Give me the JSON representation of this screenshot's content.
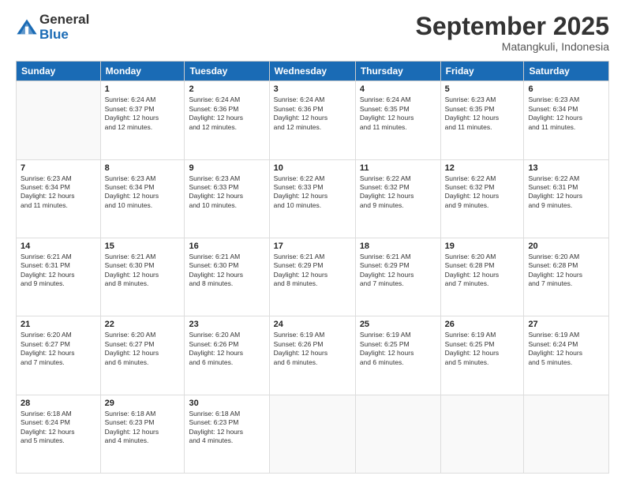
{
  "logo": {
    "general": "General",
    "blue": "Blue"
  },
  "header": {
    "month": "September 2025",
    "location": "Matangkuli, Indonesia"
  },
  "weekdays": [
    "Sunday",
    "Monday",
    "Tuesday",
    "Wednesday",
    "Thursday",
    "Friday",
    "Saturday"
  ],
  "weeks": [
    [
      {
        "day": "",
        "info": ""
      },
      {
        "day": "1",
        "info": "Sunrise: 6:24 AM\nSunset: 6:37 PM\nDaylight: 12 hours\nand 12 minutes."
      },
      {
        "day": "2",
        "info": "Sunrise: 6:24 AM\nSunset: 6:36 PM\nDaylight: 12 hours\nand 12 minutes."
      },
      {
        "day": "3",
        "info": "Sunrise: 6:24 AM\nSunset: 6:36 PM\nDaylight: 12 hours\nand 12 minutes."
      },
      {
        "day": "4",
        "info": "Sunrise: 6:24 AM\nSunset: 6:35 PM\nDaylight: 12 hours\nand 11 minutes."
      },
      {
        "day": "5",
        "info": "Sunrise: 6:23 AM\nSunset: 6:35 PM\nDaylight: 12 hours\nand 11 minutes."
      },
      {
        "day": "6",
        "info": "Sunrise: 6:23 AM\nSunset: 6:34 PM\nDaylight: 12 hours\nand 11 minutes."
      }
    ],
    [
      {
        "day": "7",
        "info": "Sunrise: 6:23 AM\nSunset: 6:34 PM\nDaylight: 12 hours\nand 11 minutes."
      },
      {
        "day": "8",
        "info": "Sunrise: 6:23 AM\nSunset: 6:34 PM\nDaylight: 12 hours\nand 10 minutes."
      },
      {
        "day": "9",
        "info": "Sunrise: 6:23 AM\nSunset: 6:33 PM\nDaylight: 12 hours\nand 10 minutes."
      },
      {
        "day": "10",
        "info": "Sunrise: 6:22 AM\nSunset: 6:33 PM\nDaylight: 12 hours\nand 10 minutes."
      },
      {
        "day": "11",
        "info": "Sunrise: 6:22 AM\nSunset: 6:32 PM\nDaylight: 12 hours\nand 9 minutes."
      },
      {
        "day": "12",
        "info": "Sunrise: 6:22 AM\nSunset: 6:32 PM\nDaylight: 12 hours\nand 9 minutes."
      },
      {
        "day": "13",
        "info": "Sunrise: 6:22 AM\nSunset: 6:31 PM\nDaylight: 12 hours\nand 9 minutes."
      }
    ],
    [
      {
        "day": "14",
        "info": "Sunrise: 6:21 AM\nSunset: 6:31 PM\nDaylight: 12 hours\nand 9 minutes."
      },
      {
        "day": "15",
        "info": "Sunrise: 6:21 AM\nSunset: 6:30 PM\nDaylight: 12 hours\nand 8 minutes."
      },
      {
        "day": "16",
        "info": "Sunrise: 6:21 AM\nSunset: 6:30 PM\nDaylight: 12 hours\nand 8 minutes."
      },
      {
        "day": "17",
        "info": "Sunrise: 6:21 AM\nSunset: 6:29 PM\nDaylight: 12 hours\nand 8 minutes."
      },
      {
        "day": "18",
        "info": "Sunrise: 6:21 AM\nSunset: 6:29 PM\nDaylight: 12 hours\nand 7 minutes."
      },
      {
        "day": "19",
        "info": "Sunrise: 6:20 AM\nSunset: 6:28 PM\nDaylight: 12 hours\nand 7 minutes."
      },
      {
        "day": "20",
        "info": "Sunrise: 6:20 AM\nSunset: 6:28 PM\nDaylight: 12 hours\nand 7 minutes."
      }
    ],
    [
      {
        "day": "21",
        "info": "Sunrise: 6:20 AM\nSunset: 6:27 PM\nDaylight: 12 hours\nand 7 minutes."
      },
      {
        "day": "22",
        "info": "Sunrise: 6:20 AM\nSunset: 6:27 PM\nDaylight: 12 hours\nand 6 minutes."
      },
      {
        "day": "23",
        "info": "Sunrise: 6:20 AM\nSunset: 6:26 PM\nDaylight: 12 hours\nand 6 minutes."
      },
      {
        "day": "24",
        "info": "Sunrise: 6:19 AM\nSunset: 6:26 PM\nDaylight: 12 hours\nand 6 minutes."
      },
      {
        "day": "25",
        "info": "Sunrise: 6:19 AM\nSunset: 6:25 PM\nDaylight: 12 hours\nand 6 minutes."
      },
      {
        "day": "26",
        "info": "Sunrise: 6:19 AM\nSunset: 6:25 PM\nDaylight: 12 hours\nand 5 minutes."
      },
      {
        "day": "27",
        "info": "Sunrise: 6:19 AM\nSunset: 6:24 PM\nDaylight: 12 hours\nand 5 minutes."
      }
    ],
    [
      {
        "day": "28",
        "info": "Sunrise: 6:18 AM\nSunset: 6:24 PM\nDaylight: 12 hours\nand 5 minutes."
      },
      {
        "day": "29",
        "info": "Sunrise: 6:18 AM\nSunset: 6:23 PM\nDaylight: 12 hours\nand 4 minutes."
      },
      {
        "day": "30",
        "info": "Sunrise: 6:18 AM\nSunset: 6:23 PM\nDaylight: 12 hours\nand 4 minutes."
      },
      {
        "day": "",
        "info": ""
      },
      {
        "day": "",
        "info": ""
      },
      {
        "day": "",
        "info": ""
      },
      {
        "day": "",
        "info": ""
      }
    ]
  ]
}
